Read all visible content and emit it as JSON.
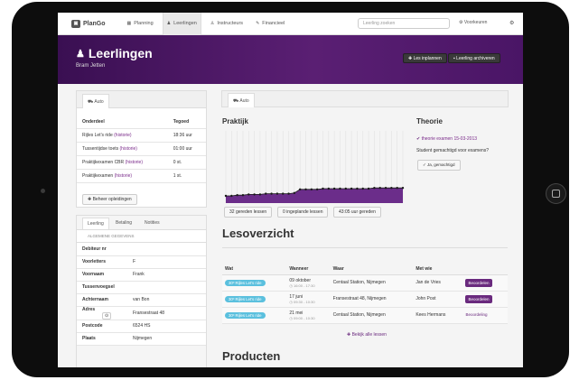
{
  "nav": {
    "logo": "PlanGo",
    "items": [
      {
        "label": "Planning",
        "icon": "▦",
        "active": false
      },
      {
        "label": "Leerlingen",
        "icon": "♟",
        "active": true
      },
      {
        "label": "Instructeurs",
        "icon": "♙",
        "active": false
      },
      {
        "label": "Financieel",
        "icon": "✎",
        "active": false
      }
    ],
    "search_placeholder": "Leerling zoeken",
    "preferences": "Voorkeuren"
  },
  "header": {
    "title": "Leerlingen",
    "subtitle": "Bram Jetten",
    "btn_schedule": "Les inplannen",
    "btn_archive": "Leerling archiveren"
  },
  "left_panel": {
    "tab": "Auto",
    "col_part": "Onderdeel",
    "col_credit": "Tegoed",
    "rows": [
      {
        "name": "Rijles Let's ride",
        "link": "(historie)",
        "value": "18:36 uur"
      },
      {
        "name": "Tussentijdse toets",
        "link": "(historie)",
        "value": "01:00 uur"
      },
      {
        "name": "Praktijkexamen CBR",
        "link": "(historie)",
        "value": "0 st."
      },
      {
        "name": "Praktijkexamen",
        "link": "(historie)",
        "value": "1 st."
      }
    ],
    "manage_button": "Beheer opleidingen"
  },
  "student_panel": {
    "tabs": [
      "Leerling",
      "Betaling",
      "Notities"
    ],
    "section": "ALGEMENE GEGEVENS",
    "fields": [
      {
        "label": "Debiteur nr",
        "value": ""
      },
      {
        "label": "Voorletters",
        "value": "F"
      },
      {
        "label": "Voornaam",
        "value": "Frank"
      },
      {
        "label": "Tussenvoegsel",
        "value": ""
      },
      {
        "label": "Achternaam",
        "value": "van Bon"
      },
      {
        "label": "Adres",
        "value": "Fransestraat 48"
      },
      {
        "label": "Postcode",
        "value": "6524 HS"
      },
      {
        "label": "Plaats",
        "value": "Nijmegen"
      }
    ]
  },
  "right_panel": {
    "tab": "Auto",
    "praktijk": "Praktijk",
    "theorie": "Theorie",
    "theory_item": "theorie examen 15-03-2013",
    "approval_question": "Student gemachtigd voor examens?",
    "approval_button": "Ja, gemachtigd",
    "stats": [
      "32 gereden lessen",
      "0 ingeplande lessen",
      "43:05 uur gereden"
    ]
  },
  "chart_data": {
    "type": "area",
    "values": [
      10,
      10,
      11,
      11,
      12,
      12,
      12,
      13,
      13,
      13,
      13,
      13,
      14,
      19,
      19,
      19,
      19,
      20,
      20,
      20,
      20,
      20,
      20,
      20,
      20,
      20,
      21,
      21,
      21,
      21,
      21,
      21
    ],
    "ylim": [
      0,
      100
    ],
    "color": "#6b2d8a"
  },
  "lessons": {
    "title": "Lesoverzicht",
    "cols": [
      "Wat",
      "Wanneer",
      "Waar",
      "Met wie"
    ],
    "rows": [
      {
        "what": "30º Rijles Let's ride",
        "date": "09 oktober",
        "time": "16:00 - 17:30",
        "where": "Centaal Station, Nijmegen",
        "who": "Jan de Vries",
        "action": "Beoordelen"
      },
      {
        "what": "30º Rijles Let's ride",
        "date": "17 juni",
        "time": "09:30 - 10:30",
        "where": "Fransestraat 48, Nijmegen",
        "who": "John Post",
        "action": "Beoordelen"
      },
      {
        "what": "30º Rijles Let's ride",
        "date": "21 mei",
        "time": "09:00 - 10:30",
        "where": "Centaal Station, Nijmegen",
        "who": "Kees Hermans",
        "action": "Beoordeling"
      }
    ],
    "all_link": "Bekijk alle lessen"
  },
  "products": {
    "title": "Producten"
  }
}
